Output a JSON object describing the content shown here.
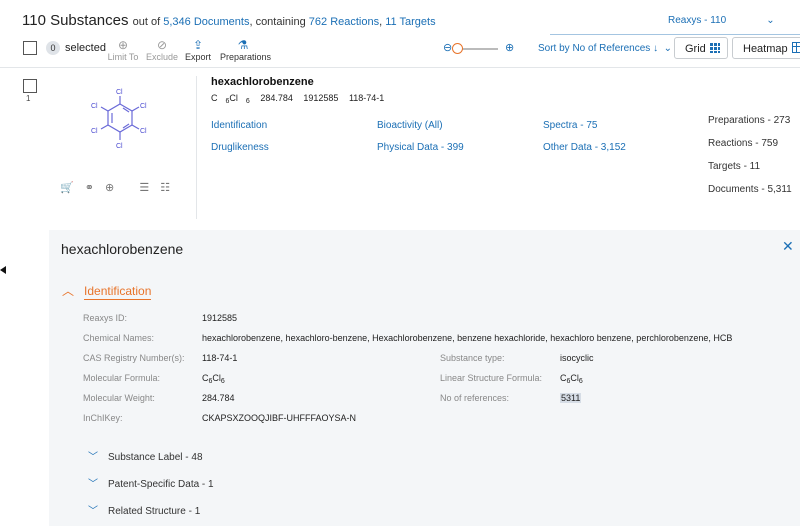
{
  "header": {
    "count_title": "110 Substances",
    "out_of": "out of",
    "documents_link": "5,346 Documents",
    "containing": ", containing",
    "reactions_link": "762 Reactions",
    "comma": ",",
    "targets_link": "11 Targets",
    "reaxys_selector": "Reaxys - 110"
  },
  "toolbar": {
    "selected_count": "0",
    "selected_label": "selected",
    "limit_to": "Limit To",
    "exclude": "Exclude",
    "export": "Export",
    "preparations": "Preparations",
    "sort_label": "Sort by No of References",
    "grid_label": "Grid",
    "heatmap_label": "Heatmap"
  },
  "record": {
    "index": "1",
    "name": "hexachlorobenzene",
    "formula_main": "C",
    "formula_sub1": "6",
    "formula_mid": "Cl",
    "formula_sub2": "6",
    "mol_weight": "284.784",
    "reaxys_id": "1912585",
    "cas": "118-74-1",
    "structure_atoms": [
      "Cl",
      "Cl",
      "Cl",
      "Cl",
      "Cl",
      "Cl"
    ],
    "categories": {
      "identification": "Identification",
      "bioactivity": "Bioactivity (All)",
      "spectra": "Spectra - 75",
      "druglikeness": "Druglikeness",
      "physical_data": "Physical Data - 399",
      "other_data": "Other Data - 3,152"
    },
    "counts": {
      "preparations": "Preparations - 273",
      "reactions": "Reactions - 759",
      "targets": "Targets - 11",
      "documents": "Documents - 5,311"
    }
  },
  "detail": {
    "title": "hexachlorobenzene",
    "section_identification": "Identification",
    "fields": {
      "reaxys_id_label": "Reaxys ID:",
      "reaxys_id_value": "1912585",
      "chem_names_label": "Chemical Names:",
      "chem_names_value": "hexachlorobenzene, hexachloro-benzene, Hexachlorobenzene, benzene hexachloride, hexachloro benzene, perchlorobenzene, HCB",
      "cas_label": "CAS Registry Number(s):",
      "cas_value": "118-74-1",
      "substance_type_label": "Substance type:",
      "substance_type_value": "isocyclic",
      "mol_formula_label": "Molecular Formula:",
      "linear_formula_label": "Linear Structure Formula:",
      "mol_weight_label": "Molecular Weight:",
      "mol_weight_value": "284.784",
      "no_refs_label": "No of references:",
      "no_refs_value": "5311",
      "inchikey_label": "InChIKey:",
      "inchikey_value": "CKAPSXZOOQJIBF-UHFFFAOYSA-N"
    },
    "subsections": {
      "substance_label": "Substance Label - 48",
      "patent_data": "Patent-Specific Data - 1",
      "related_structure": "Related Structure - 1"
    }
  },
  "colors": {
    "accent": "#1b6fb5",
    "orange": "#e8742b"
  }
}
